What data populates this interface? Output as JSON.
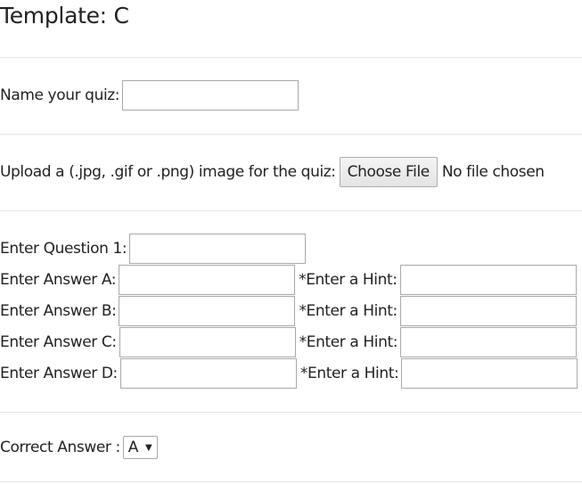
{
  "page": {
    "title": "Template: C"
  },
  "quiz_name": {
    "label": "Name your quiz:",
    "value": ""
  },
  "image_upload": {
    "label": "Upload a (.jpg, .gif or .png) image for the quiz:",
    "button_label": "Choose File",
    "status": "No file chosen"
  },
  "question": {
    "label": "Enter Question 1:",
    "value": ""
  },
  "answers": [
    {
      "label": "Enter Answer A:",
      "value": "",
      "hint_label": "*Enter a Hint:",
      "hint_value": ""
    },
    {
      "label": "Enter Answer B:",
      "value": "",
      "hint_label": "*Enter a Hint:",
      "hint_value": ""
    },
    {
      "label": "Enter Answer C:",
      "value": "",
      "hint_label": "*Enter a Hint:",
      "hint_value": ""
    },
    {
      "label": "Enter Answer D:",
      "value": "",
      "hint_label": "*Enter a Hint:",
      "hint_value": ""
    }
  ],
  "correct_answer": {
    "label": "Correct Answer :",
    "selected": "A"
  }
}
